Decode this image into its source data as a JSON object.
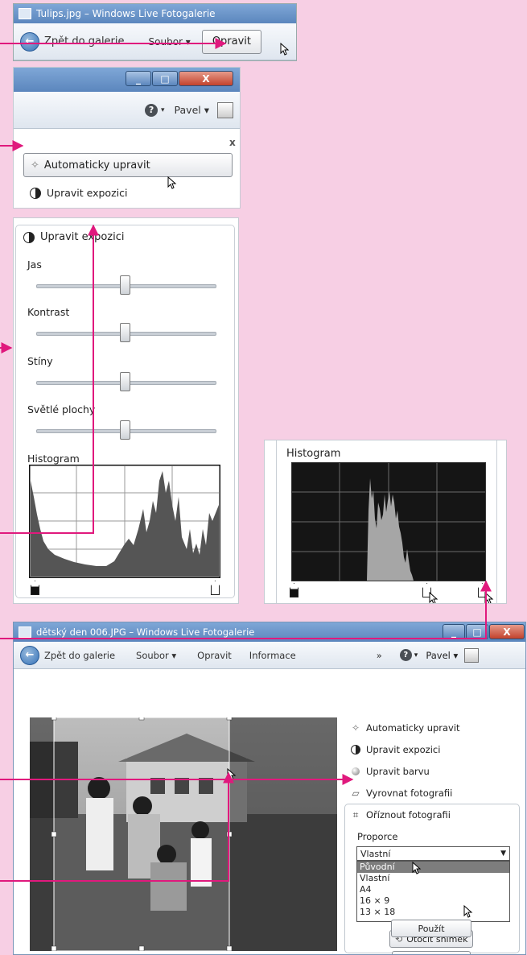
{
  "panel1": {
    "title": "Tulips.jpg – Windows Live Fotogalerie",
    "back_label": "Zpět do galerie",
    "file_menu": "Soubor ▾",
    "fix_button": "Opravit"
  },
  "panel2": {
    "minimize": "_",
    "maximize": "□",
    "close": "X",
    "help": "?",
    "user": "Pavel ▾",
    "close_pane": "x",
    "auto_fix": "Automaticky upravit",
    "adjust_exposure": "Upravit expozici"
  },
  "panel3": {
    "header": "Upravit expozici",
    "sliders": [
      {
        "label": "Jas",
        "value": 0.5
      },
      {
        "label": "Kontrast",
        "value": 0.5
      },
      {
        "label": "Stíny",
        "value": 0.5
      },
      {
        "label": "Světlé plochy",
        "value": 0.5
      }
    ],
    "histogram_label": "Histogram"
  },
  "panel4": {
    "histogram_label": "Histogram"
  },
  "panel5": {
    "title": "dětský den 006.JPG – Windows Live Fotogalerie",
    "back_label": "Zpět do galerie",
    "menu_file": "Soubor ▾",
    "menu_fix": "Opravit",
    "menu_info": "Informace",
    "overflow": "»",
    "help": "?",
    "user": "Pavel ▾",
    "tools": {
      "auto_fix": "Automaticky upravit",
      "adjust_exposure": "Upravit expozici",
      "adjust_color": "Upravit barvu",
      "straighten": "Vyrovnat fotografii",
      "crop": "Oříznout fotografii"
    },
    "proportion_label": "Proporce",
    "proportion_selected": "Vlastní",
    "proportion_options": [
      "Původní",
      "Vlastní",
      "A4",
      "16 × 9",
      "13 × 18"
    ],
    "rotate_button": "Otočit snímek",
    "apply_button": "Použít"
  },
  "colors": {
    "background": "#f7cfe4",
    "accent_arrow": "#e0197d",
    "titlebar": "#6a95c9"
  }
}
